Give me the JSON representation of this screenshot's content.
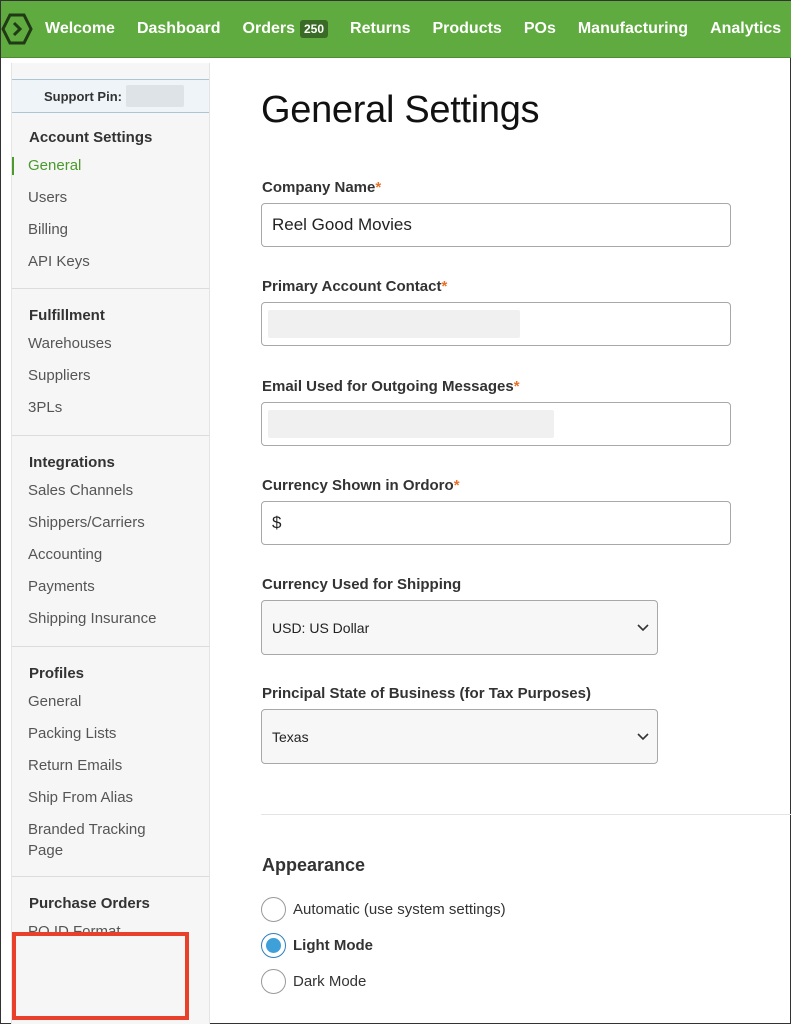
{
  "colors": {
    "nav_bg": "#5fab3f",
    "accent": "#4a9a2c",
    "required": "#e8702a",
    "highlight": "#e8402a",
    "radio_checked": "#3ea0d8"
  },
  "nav": {
    "logo_icon": "ordoro-logo-icon",
    "items": [
      {
        "label": "Welcome"
      },
      {
        "label": "Dashboard"
      },
      {
        "label": "Orders",
        "badge": "250"
      },
      {
        "label": "Returns"
      },
      {
        "label": "Products"
      },
      {
        "label": "POs"
      },
      {
        "label": "Manufacturing"
      },
      {
        "label": "Analytics"
      }
    ]
  },
  "sidebar": {
    "support_pin_label": "Support Pin:",
    "sections": [
      {
        "heading": "Account Settings",
        "items": [
          "General",
          "Users",
          "Billing",
          "API Keys"
        ]
      },
      {
        "heading": "Fulfillment",
        "items": [
          "Warehouses",
          "Suppliers",
          "3PLs"
        ]
      },
      {
        "heading": "Integrations",
        "items": [
          "Sales Channels",
          "Shippers/Carriers",
          "Accounting",
          "Payments",
          "Shipping Insurance"
        ]
      },
      {
        "heading": "Profiles",
        "items": [
          "General",
          "Packing Lists",
          "Return Emails",
          "Ship From Alias",
          "Branded Tracking Page"
        ]
      },
      {
        "heading": "Purchase Orders",
        "items": [
          "PO ID Format"
        ]
      }
    ],
    "active_item": "General"
  },
  "main": {
    "title": "General Settings",
    "company_name": {
      "label": "Company Name",
      "required": "*",
      "value": "Reel Good Movies"
    },
    "primary_contact": {
      "label": "Primary Account Contact",
      "required": "*"
    },
    "email_outgoing": {
      "label": "Email Used for Outgoing Messages",
      "required": "*"
    },
    "currency_shown": {
      "label": "Currency Shown in Ordoro",
      "required": "*",
      "value": "$"
    },
    "currency_shipping": {
      "label": "Currency Used for Shipping",
      "value": "USD: US Dollar"
    },
    "principal_state": {
      "label": "Principal State of Business (for Tax Purposes)",
      "value": "Texas"
    },
    "appearance": {
      "title": "Appearance",
      "options": [
        {
          "label": "Automatic (use system settings)",
          "checked": false
        },
        {
          "label": "Light Mode",
          "checked": true
        },
        {
          "label": "Dark Mode",
          "checked": false
        }
      ]
    }
  }
}
